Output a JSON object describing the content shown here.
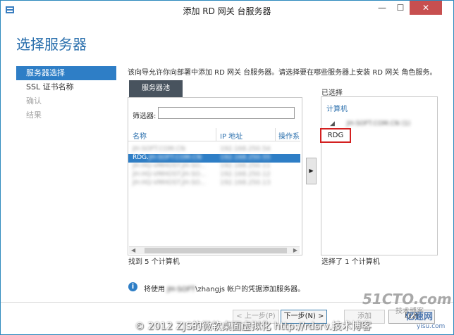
{
  "window": {
    "title": "添加 RD 网关 台服务器",
    "minimize_label": "—",
    "maximize_label": "☐",
    "close_label": "✕"
  },
  "page_title": "选择服务器",
  "steps": [
    {
      "label": "服务器选择",
      "state": "active"
    },
    {
      "label": "SSL 证书名称",
      "state": "normal"
    },
    {
      "label": "确认",
      "state": "disabled"
    },
    {
      "label": "结果",
      "state": "disabled"
    }
  ],
  "description": "该向导允许你向部署中添加 RD 网关 台服务器。请选择要在哪些服务器上安装 RD 网关 角色服务。",
  "server_pool": {
    "tab_label": "服务器池",
    "filter_label": "筛选器:",
    "filter_value": "",
    "columns": [
      "名称",
      "IP 地址",
      "操作系"
    ],
    "rows": [
      {
        "name": "JH-SOFT.COM.CN",
        "ip": "192.168.250.54",
        "selected": false
      },
      {
        "name": "RDG.",
        "name_suffix": "JH-SOFT.COM.CN",
        "ip": "192.168.250.55",
        "selected": true
      },
      {
        "name": "JH-HQ-VMHOST.JH-SO...",
        "ip": "192.168.250.11",
        "selected": false
      },
      {
        "name": "JH-HQ-VMHOST.JH-SO...",
        "ip": "192.168.250.12",
        "selected": false
      },
      {
        "name": "JH-HQ-VMHOST.JH-SO...",
        "ip": "192.168.250.13",
        "selected": false
      }
    ],
    "found_text": "找到 5 个计算机"
  },
  "add_button_label": "▶",
  "selected": {
    "label": "已选择",
    "column": "计算机",
    "domain": "JH-SOFT.COM.CN (1)",
    "item": "RDG",
    "count_text": "选择了 1 个计算机"
  },
  "info": {
    "prefix": "将使用",
    "blurred": "JH-SOFT",
    "suffix": "\\zhangjs 帐户的凭据添加服务器。"
  },
  "buttons": {
    "previous": "< 上一步(P)",
    "next": "下一步(N) >",
    "install": "添加",
    "cancel": "取消"
  },
  "watermarks": {
    "copyright": "© 2012 ZJS的微软桌面虚拟化 http://rdsrv.技术博客",
    "logo": "51CTO.com",
    "blog": "技术博客",
    "site": "亿速网",
    "url": "yisu.com"
  },
  "colors": {
    "accent": "#2e7ec6",
    "title": "#2a6fad",
    "close": "#c74f4f",
    "highlight_box": "#d32020"
  }
}
